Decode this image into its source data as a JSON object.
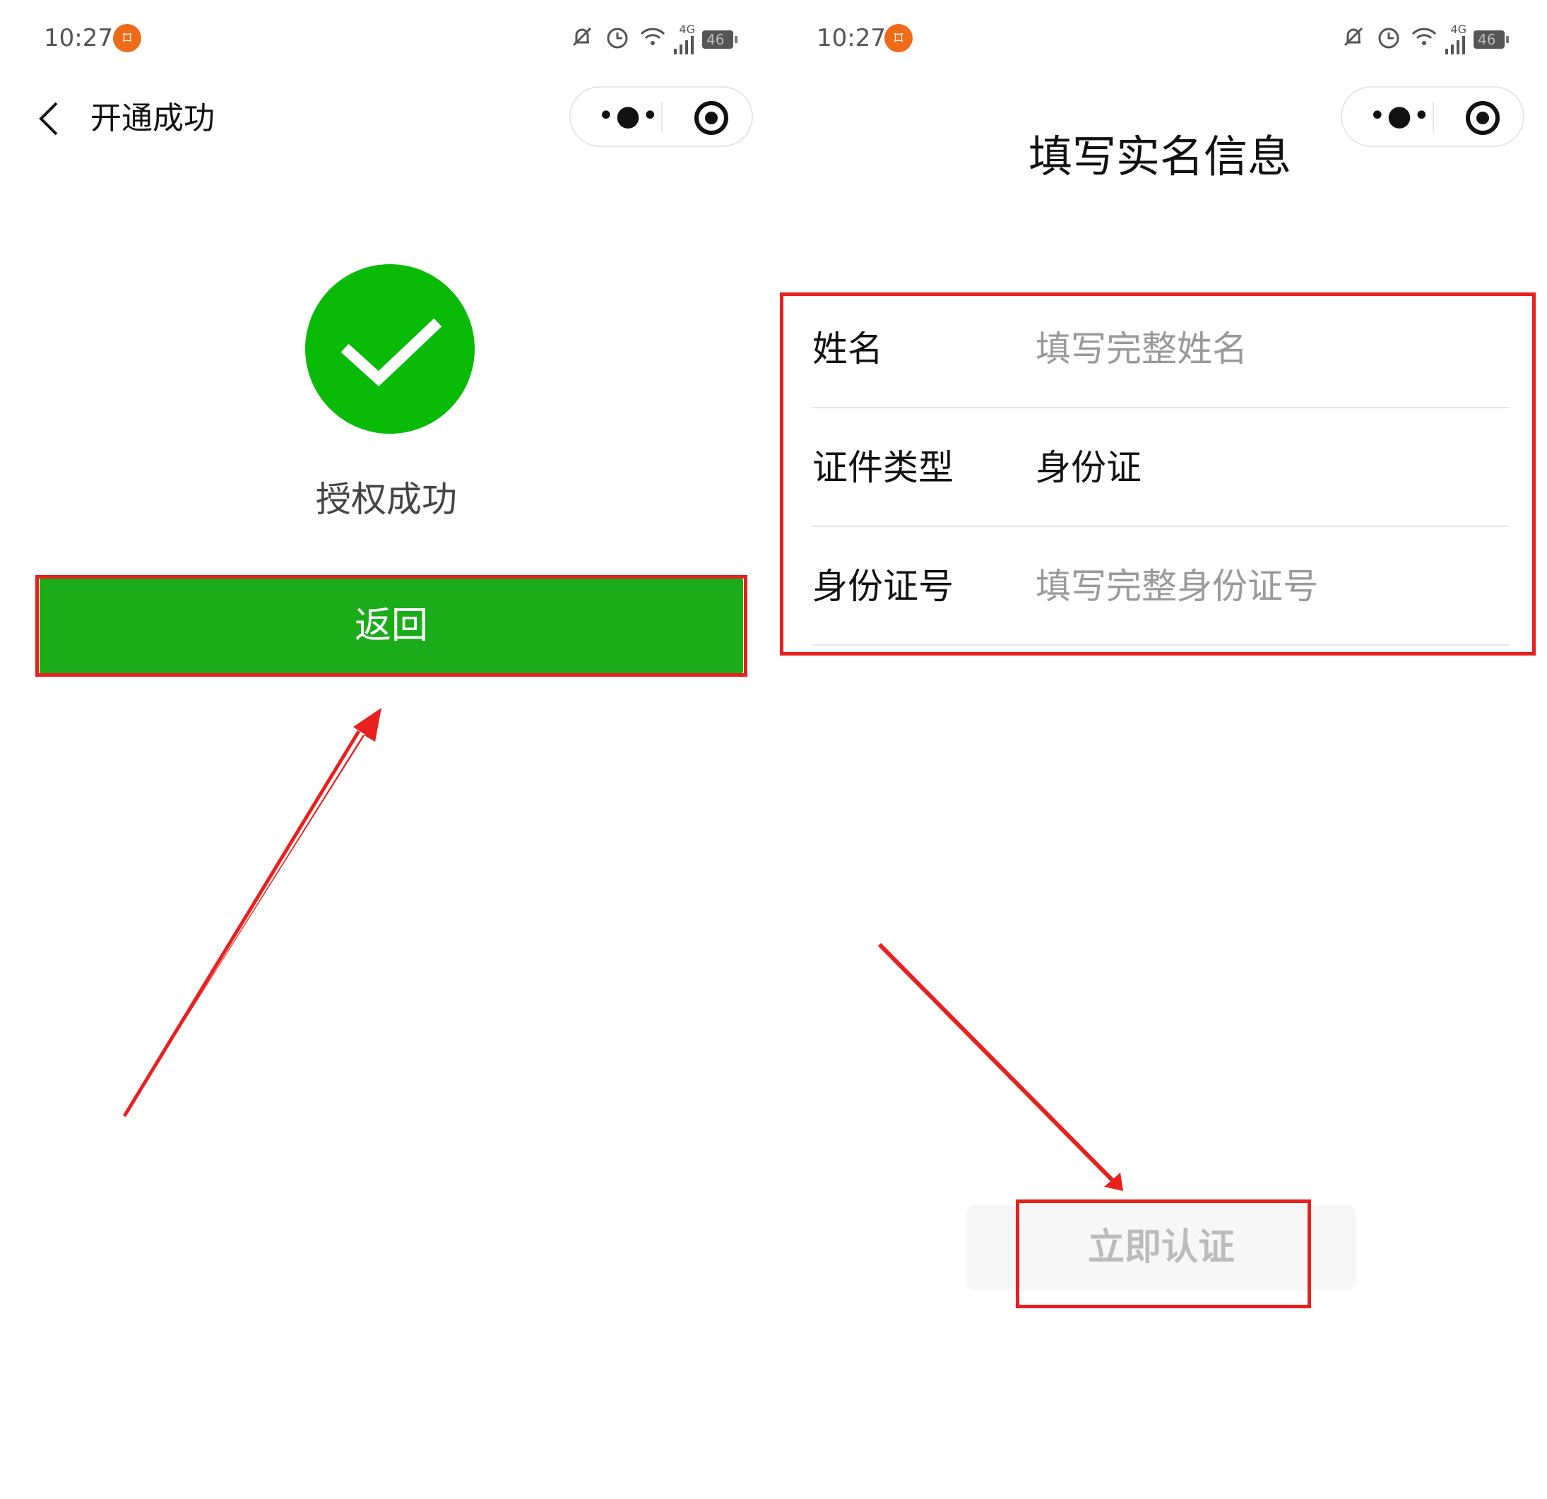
{
  "left_screen": {
    "status": {
      "time": "10:27",
      "network": "4G",
      "battery": "46"
    },
    "nav": {
      "title": "开通成功"
    },
    "result": {
      "message": "授权成功"
    },
    "return_button": "返回"
  },
  "right_screen": {
    "status": {
      "time": "10:27",
      "network": "4G",
      "battery": "46"
    },
    "title": "填写实名信息",
    "form": [
      {
        "label": "姓名",
        "placeholder": "填写完整姓名",
        "value": ""
      },
      {
        "label": "证件类型",
        "value": "身份证"
      },
      {
        "label": "身份证号",
        "placeholder": "填写完整身份证号",
        "value": ""
      }
    ],
    "verify_button": "立即认证"
  },
  "colors": {
    "success_green": "#09bb07",
    "button_green": "#1aad19",
    "annotation_red": "#e8201e",
    "placeholder_gray": "#9a9a9a",
    "disabled_button_bg": "#f7f7f7"
  },
  "icons": [
    "back-chevron-icon",
    "more-dots-icon",
    "target-circle-icon",
    "checkmark-icon",
    "mute-bell-icon",
    "alarm-icon",
    "wifi-icon",
    "signal-icon",
    "battery-icon",
    "app-notification-icon"
  ]
}
